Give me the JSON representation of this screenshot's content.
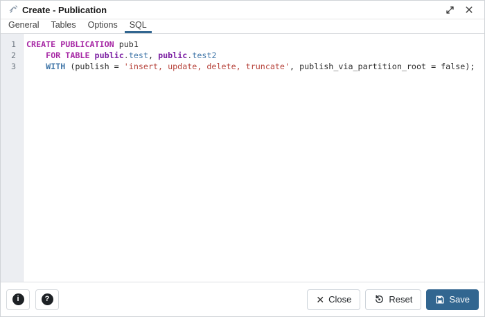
{
  "window": {
    "title": "Create - Publication"
  },
  "titlebar_icons": {
    "app": "satellite-dish",
    "maximize": "expand-diagonal",
    "close_glyph": "✕"
  },
  "tabs": [
    {
      "label": "General",
      "active": false
    },
    {
      "label": "Tables",
      "active": false
    },
    {
      "label": "Options",
      "active": false
    },
    {
      "label": "SQL",
      "active": true
    }
  ],
  "editor": {
    "lines": [
      {
        "number": "1",
        "segments": [
          {
            "text": "CREATE PUBLICATION",
            "style": "keyword"
          },
          {
            "text": " pub1",
            "style": "plain"
          }
        ]
      },
      {
        "number": "2",
        "segments": [
          {
            "text": "    ",
            "style": "plain"
          },
          {
            "text": "FOR TABLE",
            "style": "keyword"
          },
          {
            "text": " ",
            "style": "plain"
          },
          {
            "text": "public",
            "style": "builtin"
          },
          {
            "text": ".",
            "style": "punct"
          },
          {
            "text": "test",
            "style": "variable"
          },
          {
            "text": ", ",
            "style": "plain"
          },
          {
            "text": "public",
            "style": "builtin"
          },
          {
            "text": ".",
            "style": "punct"
          },
          {
            "text": "test2",
            "style": "variable"
          }
        ]
      },
      {
        "number": "3",
        "segments": [
          {
            "text": "    ",
            "style": "plain"
          },
          {
            "text": "WITH",
            "style": "variable-bold"
          },
          {
            "text": " (publish = ",
            "style": "plain"
          },
          {
            "text": "'insert, update, delete, truncate'",
            "style": "string"
          },
          {
            "text": ", publish_via_partition_root = false);",
            "style": "plain"
          }
        ]
      }
    ]
  },
  "footer": {
    "info_glyph": "i",
    "help_glyph": "?",
    "close_label": "Close",
    "reset_label": "Reset",
    "save_label": "Save"
  },
  "colors": {
    "accent": "#326690",
    "keyword": "#a626a4",
    "builtin": "#7b1fa2",
    "variable": "#4076a8",
    "string": "#b6423a",
    "gutter_bg": "#eceef2"
  }
}
